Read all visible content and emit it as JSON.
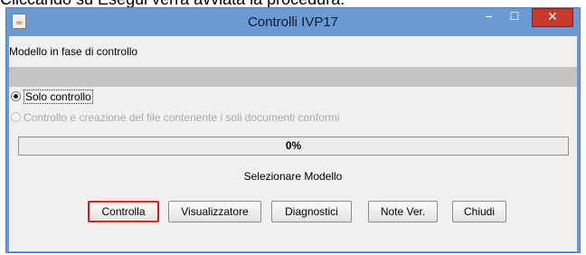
{
  "caption": {
    "text": "Cliccando su Esegui verrà avviata la procedura."
  },
  "window": {
    "title": "Controlli IVP17",
    "icon": "java-app-icon",
    "controls": {
      "minimize": "–",
      "maximize": "☐",
      "close": "✕"
    }
  },
  "panel": {
    "section_label": "Modello in fase di controllo",
    "options": [
      {
        "label": "Solo controllo",
        "selected": true,
        "enabled": true
      },
      {
        "label": "Controllo e creazione del file contenente i soli documenti conformi",
        "selected": false,
        "enabled": false
      }
    ],
    "progress": {
      "value": 0,
      "label": "0%"
    },
    "status": "Selezionare Modello"
  },
  "buttons": {
    "controlla": "Controlla",
    "visualizzatore": "Visualizzatore",
    "diagnostici": "Diagnostici",
    "note_ver": "Note Ver.",
    "chiudi": "Chiudi"
  },
  "colors": {
    "title_bar": "#6b9ad3",
    "close_button": "#c7392d",
    "highlight": "#e0141e",
    "panel": "#f0f0f0"
  }
}
